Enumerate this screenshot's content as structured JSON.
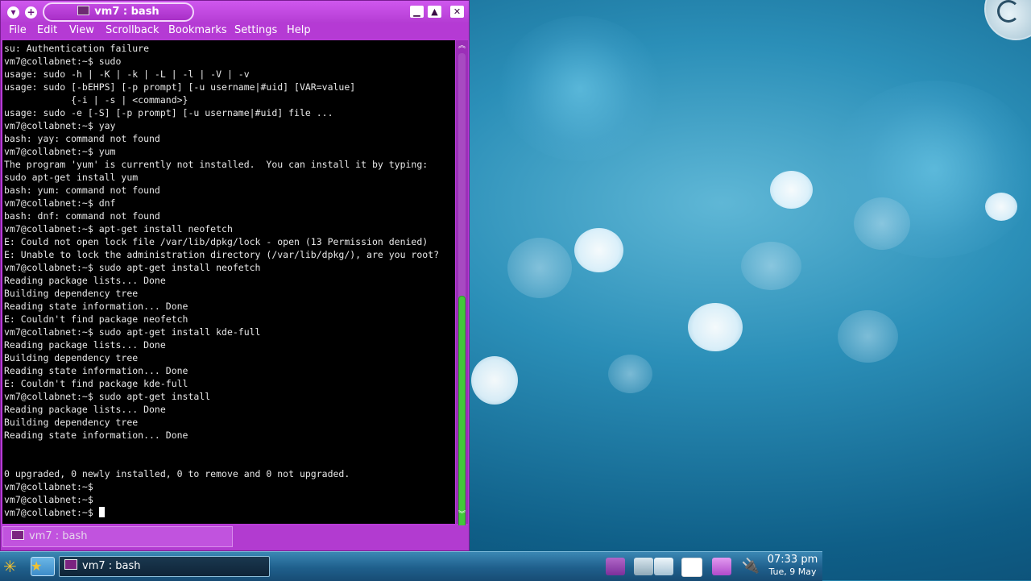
{
  "window": {
    "title": "vm7 : bash",
    "menu": [
      "File",
      "Edit",
      "View",
      "Scrollback",
      "Bookmarks",
      "Settings",
      "Help"
    ],
    "tab_label": "vm7 : bash"
  },
  "terminal": {
    "lines": [
      "su: Authentication failure",
      "vm7@collabnet:~$ sudo",
      "usage: sudo -h | -K | -k | -L | -l | -V | -v",
      "usage: sudo [-bEHPS] [-p prompt] [-u username|#uid] [VAR=value]",
      "            {-i | -s | <command>}",
      "usage: sudo -e [-S] [-p prompt] [-u username|#uid] file ...",
      "vm7@collabnet:~$ yay",
      "bash: yay: command not found",
      "vm7@collabnet:~$ yum",
      "The program 'yum' is currently not installed.  You can install it by typing:",
      "sudo apt-get install yum",
      "bash: yum: command not found",
      "vm7@collabnet:~$ dnf",
      "bash: dnf: command not found",
      "vm7@collabnet:~$ apt-get install neofetch",
      "E: Could not open lock file /var/lib/dpkg/lock - open (13 Permission denied)",
      "E: Unable to lock the administration directory (/var/lib/dpkg/), are you root?",
      "vm7@collabnet:~$ sudo apt-get install neofetch",
      "Reading package lists... Done",
      "Building dependency tree",
      "Reading state information... Done",
      "E: Couldn't find package neofetch",
      "vm7@collabnet:~$ sudo apt-get install kde-full",
      "Reading package lists... Done",
      "Building dependency tree",
      "Reading state information... Done",
      "E: Couldn't find package kde-full",
      "vm7@collabnet:~$ sudo apt-get install",
      "Reading package lists... Done",
      "Building dependency tree",
      "Reading state information... Done",
      "",
      "",
      "0 upgraded, 0 newly installed, 0 to remove and 0 not upgraded.",
      "vm7@collabnet:~$",
      "vm7@collabnet:~$"
    ],
    "prompt": "vm7@collabnet:~$ "
  },
  "taskbar": {
    "task_label": "vm7 : bash",
    "clock_time": "07:33 pm",
    "clock_date": "Tue, 9 May"
  }
}
